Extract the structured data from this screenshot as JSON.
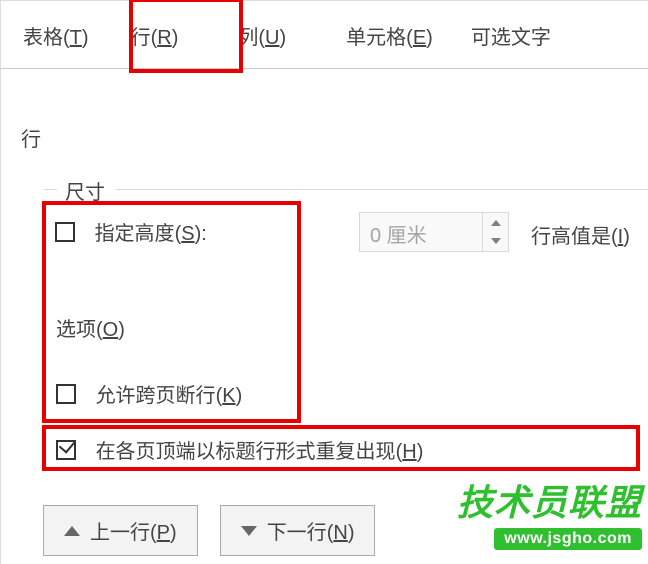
{
  "tabs": {
    "table": {
      "label": "表格",
      "accel": "T"
    },
    "row": {
      "label": "行",
      "accel": "R"
    },
    "column": {
      "label": "列",
      "accel": "U"
    },
    "cell": {
      "label": "单元格",
      "accel": "E"
    },
    "alt": {
      "label": "可选文字"
    }
  },
  "section": {
    "title": "行"
  },
  "size_group": {
    "legend": "尺寸"
  },
  "specify_height": {
    "label": "指定高度",
    "accel": "S",
    "checked": false,
    "unit_display": "0 厘米",
    "type_label": "行高值是",
    "type_accel": "I"
  },
  "options_group": {
    "legend": "选项",
    "accel": "O"
  },
  "allow_break": {
    "label": "允许跨页断行",
    "accel": "K",
    "checked": false
  },
  "repeat_header": {
    "label": "在各页顶端以标题行形式重复出现",
    "accel": "H",
    "checked": true
  },
  "nav": {
    "prev_label": "上一行",
    "prev_accel": "P",
    "next_label": "下一行",
    "next_accel": "N"
  },
  "watermark": {
    "title": "技术员联盟",
    "url": "www.jsgho.com"
  }
}
